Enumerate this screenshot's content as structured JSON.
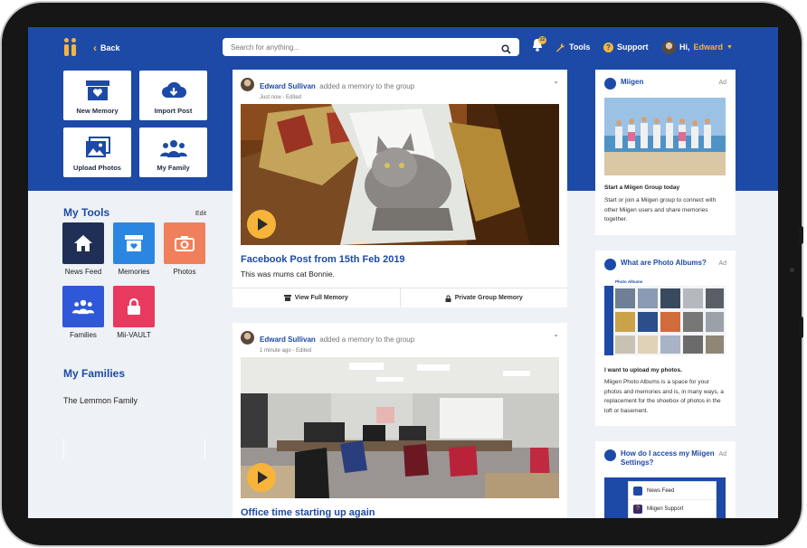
{
  "header": {
    "back_label": "Back",
    "search_placeholder": "Search for anything...",
    "notification_count": "12",
    "tools_label": "Tools",
    "support_label": "Support",
    "greeting": "Hi,",
    "user_name": "Edward"
  },
  "quick_actions": [
    {
      "label": "New Memory",
      "icon": "memory-box-icon"
    },
    {
      "label": "Import Post",
      "icon": "cloud-download-icon"
    },
    {
      "label": "Upload Photos",
      "icon": "photos-icon"
    },
    {
      "label": "My Family",
      "icon": "family-icon"
    }
  ],
  "tools": {
    "title": "My Tools",
    "edit_label": "Edit",
    "items": [
      {
        "label": "News Feed",
        "color": "#1f2f55",
        "icon": "home-icon"
      },
      {
        "label": "Memories",
        "color": "#2a86e0",
        "icon": "memory-heart-icon"
      },
      {
        "label": "Photos",
        "color": "#f07f5b",
        "icon": "camera-icon"
      },
      {
        "label": "Families",
        "color": "#2f58d8",
        "icon": "family-icon"
      },
      {
        "label": "Mii-VAULT",
        "color": "#e83a5e",
        "icon": "lock-icon"
      }
    ]
  },
  "families": {
    "title": "My Families",
    "items": [
      "The Lemmon Family"
    ]
  },
  "posts": [
    {
      "author": "Edward Sullivan",
      "action": "added a memory to the group",
      "meta": "Just now - Edited",
      "title": "Facebook Post from 15th Feb 2019",
      "description": "This was mums cat Bonnie.",
      "view_label": "View Full Memory",
      "privacy_label": "Private Group Memory"
    },
    {
      "author": "Edward Sullivan",
      "action": "added a memory to the group",
      "meta": "1 minute ago - Edited",
      "title": "Office time starting up again"
    }
  ],
  "ads": [
    {
      "title": "Miigen",
      "tag": "Ad",
      "headline": "Start a Miigen Group today",
      "body": "Start or join a Miigen group to connect with other Miigen users and share memories together."
    },
    {
      "title": "What are Photo Albums?",
      "tag": "Ad",
      "album_header": "Photo Albums",
      "headline": "I want to upload my photos.",
      "body": "Miigen Photo Albums is a space for your photos and memories and is, in many ways, a replacement for the shoebox of photos in the loft or basement."
    },
    {
      "title": "How do I access my Miigen Settings?",
      "tag": "Ad",
      "menu_items": [
        "News Feed",
        "Miigen Support"
      ]
    }
  ],
  "colors": {
    "brand_blue": "#1d4aa6",
    "accent": "#f6b53a",
    "background": "#eef1f6"
  }
}
